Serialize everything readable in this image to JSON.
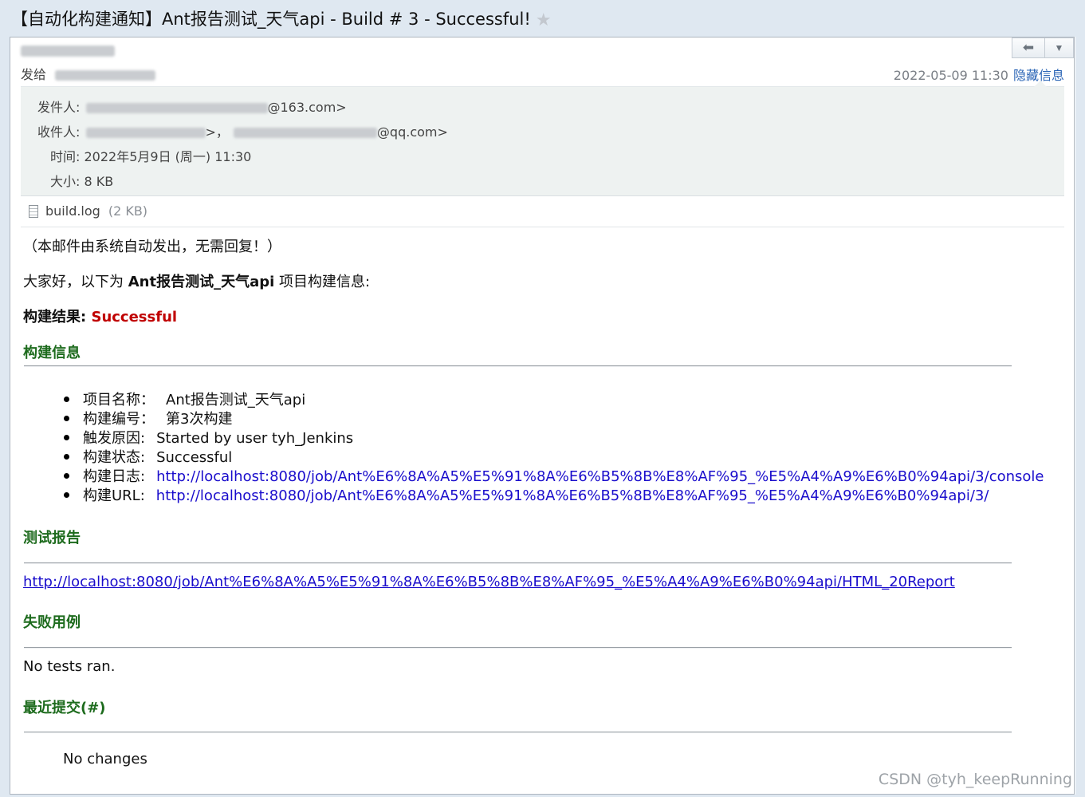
{
  "window": {
    "title": "【自动化构建通知】Ant报告测试_天气api - Build # 3 - Successful!",
    "star_icon": "star-icon"
  },
  "header": {
    "sendto_label": "发给",
    "date": "2022-05-09 11:30",
    "hide_details": "隐藏信息",
    "reply_icon": "reply-icon",
    "more_icon": "chevron-down-icon"
  },
  "details": {
    "from_label": "发件人:",
    "from_suffix": "@163.com>",
    "to_label": "收件人:",
    "to_mid": ">，",
    "to_suffix": "@qq.com>",
    "time_label": "时间:",
    "time_value": "2022年5月9日 (周一) 11:30",
    "size_label": "大小:",
    "size_value": "8 KB"
  },
  "attachment": {
    "name": "build.log",
    "size": "(2 KB)"
  },
  "body": {
    "auto_note": "（本邮件由系统自动发出，无需回复！）",
    "greeting_prefix": "大家好，以下为 ",
    "project_name": "Ant报告测试_天气api",
    "greeting_suffix": " 项目构建信息:",
    "result_label": "构建结果:",
    "result_value": "Successful",
    "build_info_heading": "构建信息",
    "info_items": [
      {
        "label": "项目名称：",
        "value": "Ant报告测试_天气api"
      },
      {
        "label": "构建编号：",
        "value": "第3次构建"
      },
      {
        "label": "触发原因:",
        "value": "Started by user tyh_Jenkins"
      },
      {
        "label": "构建状态:",
        "value": "Successful"
      },
      {
        "label": "构建日志:",
        "value": "http://localhost:8080/job/Ant%E6%8A%A5%E5%91%8A%E6%B5%8B%E8%AF%95_%E5%A4%A9%E6%B0%94api/3/console"
      },
      {
        "label": "构建URL:",
        "value": "http://localhost:8080/job/Ant%E6%8A%A5%E5%91%8A%E6%B5%8B%E8%AF%95_%E5%A4%A9%E6%B0%94api/3/"
      }
    ],
    "test_report_heading": "测试报告",
    "test_report_link": "http://localhost:8080/job/Ant%E6%8A%A5%E5%91%8A%E6%B5%8B%E8%AF%95_%E5%A4%A9%E6%B0%94api/HTML_20Report",
    "failed_cases_heading": "失败用例",
    "failed_cases_text": "No tests ran.",
    "recent_commits_heading": "最近提交(#)",
    "recent_commits_text": "No changes"
  },
  "watermark": "CSDN @tyh_keepRunning",
  "colors": {
    "success_red": "#c00000",
    "heading_green": "#1d6b1d",
    "link_blue": "#1a0dcc",
    "details_bg": "#eef2f1",
    "titlebar_bg": "#dfe8f1"
  }
}
